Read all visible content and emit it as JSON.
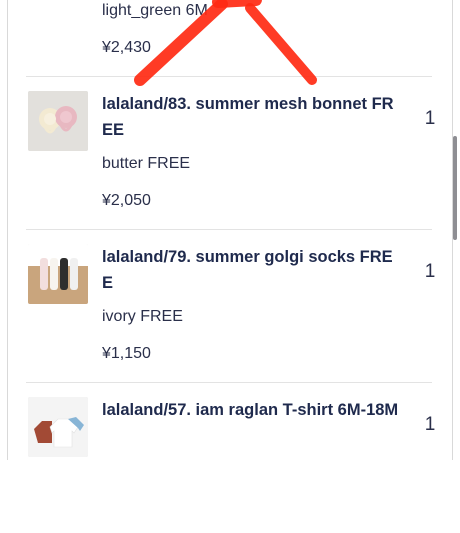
{
  "colors": {
    "text": "#2a2f4a",
    "title": "#1f2a4d",
    "divider": "#e3e3e3",
    "annotation": "#ff2a12"
  },
  "top_item": {
    "variant": "light_green 6M",
    "price": "¥2,430"
  },
  "items": [
    {
      "name": "lalaland/83. summer mesh bonnet FREE",
      "variant": "butter FREE",
      "price": "¥2,050",
      "quantity": "1",
      "thumbnail": "bonnet-thumbnail"
    },
    {
      "name": "lalaland/79. summer golgi socks FREE",
      "variant": "ivory FREE",
      "price": "¥1,150",
      "quantity": "1",
      "thumbnail": "socks-thumbnail"
    },
    {
      "name": "lalaland/57. iam raglan T-shirt 6M-18M",
      "variant": "",
      "price": "",
      "quantity": "1",
      "thumbnail": "tshirt-thumbnail"
    }
  ]
}
